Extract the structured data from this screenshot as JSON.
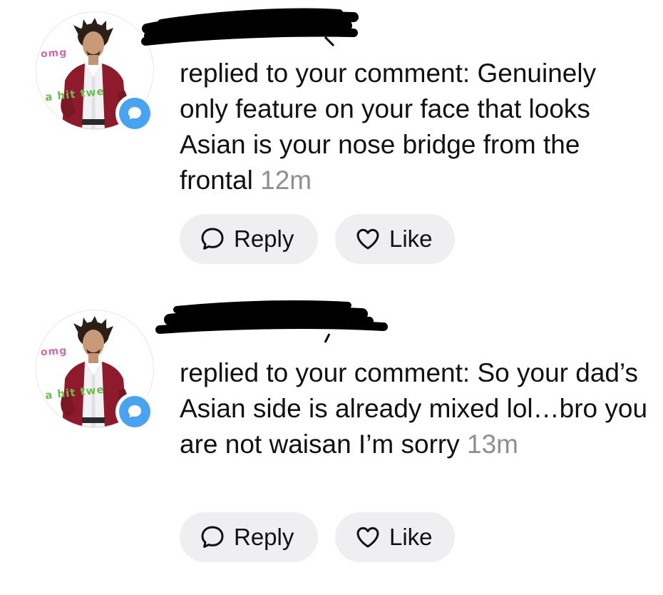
{
  "notifications": [
    {
      "avatar": {
        "overlay_top": "omg",
        "overlay_bottom": "a hit twe"
      },
      "badge_icon": "reply-bubble-icon",
      "username_redacted": true,
      "action_text": "replied to your comment:",
      "comment": "Genuinely only feature on your face that looks Asian is your nose bridge from the frontal",
      "timestamp": "12m",
      "buttons": {
        "reply_label": "Reply",
        "like_label": "Like"
      }
    },
    {
      "avatar": {
        "overlay_top": "omg",
        "overlay_bottom": "a hit twe"
      },
      "badge_icon": "reply-bubble-icon",
      "username_redacted": true,
      "action_text": "replied to your comment:",
      "comment": "So your dad’s Asian side is already mixed lol…bro you are not waisan I’m sorry",
      "timestamp": "13m",
      "buttons": {
        "reply_label": "Reply",
        "like_label": "Like"
      }
    }
  ],
  "colors": {
    "badge": "#4aa3f0",
    "button_bg": "#efeff1",
    "timestamp": "#8e8e93",
    "text": "#111111"
  }
}
